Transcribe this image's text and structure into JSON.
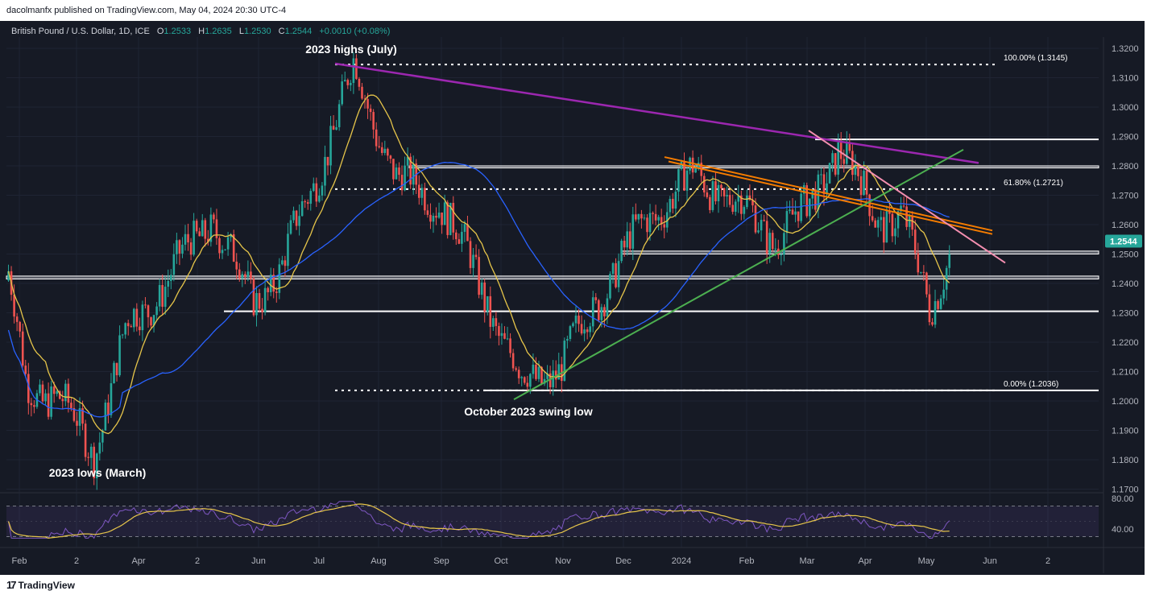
{
  "publisher": "dacolmanfx published on TradingView.com, May 04, 2024 20:30 UTC-4",
  "header": {
    "symbol": "British Pound / U.S. Dollar, 1D, ICE",
    "o_label": "O",
    "o_value": "1.2533",
    "h_label": "H",
    "h_value": "1.2635",
    "l_label": "L",
    "l_value": "1.2530",
    "c_label": "C",
    "c_value": "1.2544",
    "change": "+0.0010 (+0.08%)"
  },
  "footer": {
    "brand": "TradingView",
    "logo_icon": "tradingview-logo-icon"
  },
  "colors": {
    "background": "#161a25",
    "up": "#26a69a",
    "down": "#ef5350",
    "ma_fast": "#e6c54a",
    "ma_slow": "#2962ff",
    "resistance_long": "#9c27b0",
    "channel": "#f57c00",
    "trend_up": "#4caf50",
    "trend_down": "#f48fb1",
    "rsi": "#7e57c2",
    "rsi_ma": "#e6c54a"
  },
  "chart_data": {
    "type": "candlestick",
    "title": "British Pound / U.S. Dollar, 1D, ICE",
    "last_price": "1.2544",
    "x_ticks": [
      "Feb",
      "2",
      "Apr",
      "2",
      "Jun",
      "Jul",
      "Aug",
      "Sep",
      "Oct",
      "Nov",
      "Dec",
      "2024",
      "Feb",
      "Mar",
      "Apr",
      "May",
      "Jun",
      "2"
    ],
    "y_ticks": [
      "1.3200",
      "1.3100",
      "1.3000",
      "1.2900",
      "1.2800",
      "1.2700",
      "1.2600",
      "1.2500",
      "1.2400",
      "1.2300",
      "1.2200",
      "1.2100",
      "1.2000",
      "1.1900",
      "1.1800",
      "1.1700"
    ],
    "ylim": [
      1.17,
      1.325
    ],
    "fib_levels": [
      {
        "label": "100.00% (1.3145)",
        "value": 1.3145
      },
      {
        "label": "61.80% (1.2721)",
        "value": 1.2721
      },
      {
        "label": "0.00% (1.2036)",
        "value": 1.2036
      }
    ],
    "horizontal_levels": [
      1.289,
      1.28,
      1.251,
      1.2425,
      1.2305,
      1.2036
    ],
    "annotations": [
      {
        "text": "2023 highs (July)",
        "date": "2023-07-14",
        "value": 1.3145
      },
      {
        "text": "October 2023 swing low",
        "date": "2023-10-04",
        "value": 1.2036
      },
      {
        "text": "2023 lows (March)",
        "date": "2023-03-08",
        "value": 1.1803
      }
    ],
    "price_path": [
      [
        "2023-01-25",
        1.241
      ],
      [
        "2023-02-03",
        1.205
      ],
      [
        "2023-02-17",
        1.202
      ],
      [
        "2023-03-08",
        1.183
      ],
      [
        "2023-03-24",
        1.224
      ],
      [
        "2023-04-14",
        1.242
      ],
      [
        "2023-05-05",
        1.263
      ],
      [
        "2023-05-25",
        1.234
      ],
      [
        "2023-06-08",
        1.245
      ],
      [
        "2023-06-23",
        1.272
      ],
      [
        "2023-07-14",
        1.313
      ],
      [
        "2023-08-04",
        1.275
      ],
      [
        "2023-08-25",
        1.269
      ],
      [
        "2023-09-15",
        1.238
      ],
      [
        "2023-10-04",
        1.206
      ],
      [
        "2023-10-24",
        1.212
      ],
      [
        "2023-11-15",
        1.24
      ],
      [
        "2023-12-05",
        1.262
      ],
      [
        "2023-12-28",
        1.277
      ],
      [
        "2024-01-17",
        1.268
      ],
      [
        "2024-02-05",
        1.256
      ],
      [
        "2024-02-22",
        1.265
      ],
      [
        "2024-03-08",
        1.287
      ],
      [
        "2024-03-27",
        1.262
      ],
      [
        "2024-04-08",
        1.264
      ],
      [
        "2024-04-22",
        1.231
      ],
      [
        "2024-05-03",
        1.2544
      ]
    ],
    "indicators": {
      "rsi_ticks": [
        "80.00",
        "40.00"
      ],
      "rsi_ylim": [
        20,
        90
      ],
      "rsi_bands": [
        70,
        30
      ]
    }
  }
}
